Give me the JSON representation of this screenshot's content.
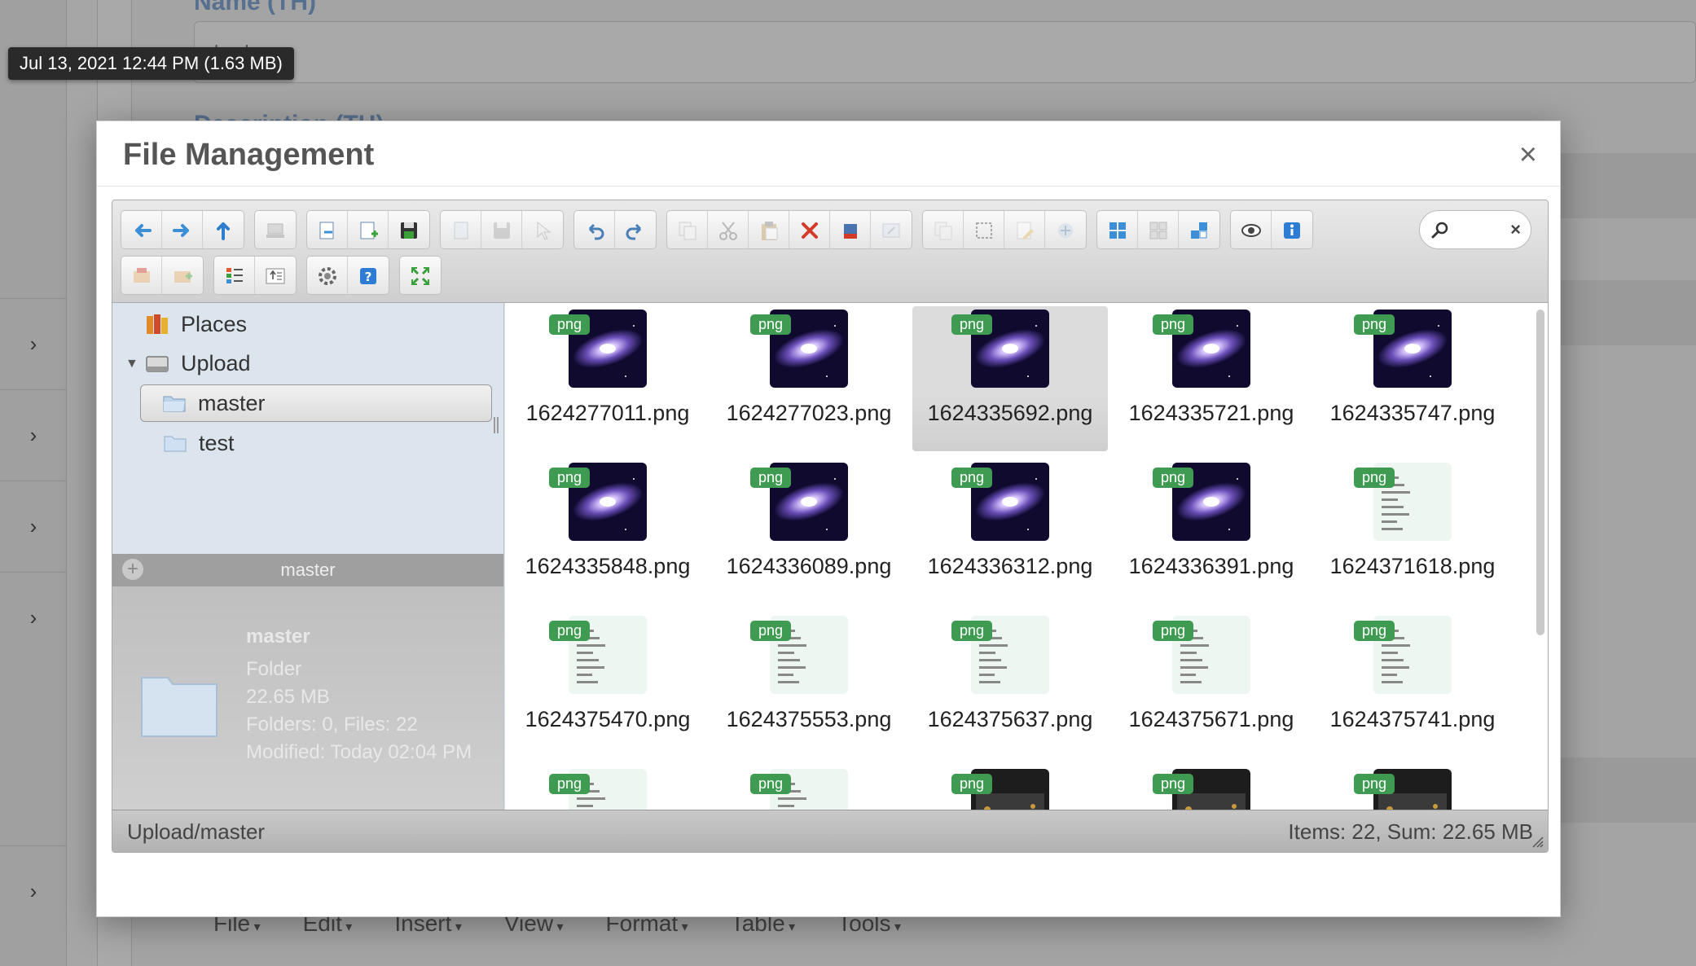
{
  "background": {
    "field1_label": "Name (TH)",
    "field1_value": "test",
    "field2_label": "Description (TH)",
    "menubar": [
      "File",
      "Edit",
      "Insert",
      "View",
      "Format",
      "Table",
      "Tools"
    ],
    "nav_chevron": "›"
  },
  "tooltip": "Jul 13, 2021 12:44 PM (1.63 MB)",
  "dialog": {
    "title": "File Management",
    "close": "×"
  },
  "toolbar": {
    "row1": [
      [
        "back-icon",
        "forward-icon",
        "up-icon"
      ],
      [
        "home-icon"
      ],
      [
        "open-icon",
        "new-file-icon",
        "save-icon"
      ],
      [
        "copy-doc-icon",
        "save-disabled-icon",
        "select-icon"
      ],
      [
        "undo-icon",
        "redo-icon"
      ],
      [
        "copy-icon",
        "cut-icon",
        "paste-icon",
        "delete-icon",
        "empty-icon",
        "rename-icon"
      ],
      [
        "duplicate-icon",
        "select-all-icon",
        "edit-icon",
        "resize-icon"
      ],
      [
        "icons-view-icon",
        "grid-view-icon",
        "tiles-view-icon"
      ],
      [
        "preview-icon",
        "info-icon"
      ]
    ],
    "row2": [
      [
        "extract-icon",
        "archive-icon"
      ],
      [
        "list-view-icon",
        "sort-icon"
      ],
      [
        "settings-icon",
        "help-icon"
      ],
      [
        "fullscreen-icon"
      ]
    ],
    "search_placeholder": "",
    "search_clear": "×"
  },
  "tree": {
    "places": "Places",
    "upload": "Upload",
    "master": "master",
    "test": "test"
  },
  "info": {
    "bar_title": "master",
    "plus": "+",
    "name": "master",
    "kind": "Folder",
    "size": "22.65 MB",
    "counts": "Folders: 0, Files: 22",
    "modified": "Modified: Today 02:04 PM"
  },
  "files": [
    {
      "name": "1624277011.png",
      "kind": "galaxy",
      "badge": "png"
    },
    {
      "name": "1624277023.png",
      "kind": "galaxy",
      "badge": "png"
    },
    {
      "name": "1624335692.png",
      "kind": "galaxy",
      "badge": "png",
      "selected": true
    },
    {
      "name": "1624335721.png",
      "kind": "galaxy",
      "badge": "png"
    },
    {
      "name": "1624335747.png",
      "kind": "galaxy",
      "badge": "png"
    },
    {
      "name": "1624335848.png",
      "kind": "galaxy",
      "badge": "png"
    },
    {
      "name": "1624336089.png",
      "kind": "galaxy",
      "badge": "png"
    },
    {
      "name": "1624336312.png",
      "kind": "galaxy",
      "badge": "png"
    },
    {
      "name": "1624336391.png",
      "kind": "galaxy",
      "badge": "png"
    },
    {
      "name": "1624371618.png",
      "kind": "doc",
      "badge": "png"
    },
    {
      "name": "1624375470.png",
      "kind": "doc",
      "badge": "png"
    },
    {
      "name": "1624375553.png",
      "kind": "doc",
      "badge": "png"
    },
    {
      "name": "1624375637.png",
      "kind": "doc",
      "badge": "png"
    },
    {
      "name": "1624375671.png",
      "kind": "doc",
      "badge": "png"
    },
    {
      "name": "1624375741.png",
      "kind": "doc",
      "badge": "png"
    },
    {
      "name": "",
      "kind": "doc",
      "badge": "png"
    },
    {
      "name": "",
      "kind": "doc",
      "badge": "png"
    },
    {
      "name": "",
      "kind": "dark",
      "badge": "png"
    },
    {
      "name": "",
      "kind": "dark",
      "badge": "png"
    },
    {
      "name": "",
      "kind": "dark",
      "badge": "png"
    }
  ],
  "statusbar": {
    "path": "Upload/master",
    "stats": "Items: 22, Sum: 22.65 MB"
  },
  "colors": {
    "badge_green": "#3e9b51",
    "nav_bg": "#dce4ee",
    "link_blue": "#254f82"
  }
}
